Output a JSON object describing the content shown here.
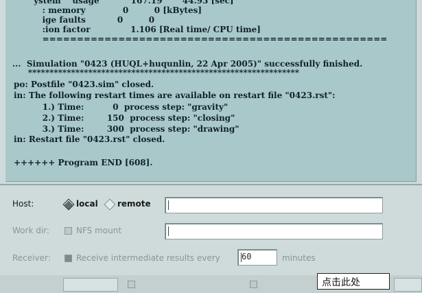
{
  "log": {
    "lines": [
      "      ystem    usage           167.19       44.93 [sec]",
      "         : memory             0         0 [kBytes]",
      "         ige faults           0         0",
      "         :ion factor              1.106 [Real time/ CPU time]",
      "         ==================================================",
      "",
      "...  Simulation \"0423 (HUQL+huqunlin, 22 Apr 2005)\" successfully finished.",
      "    ***************************************************************",
      "po: Postfile \"0423.sim\" closed.",
      "in: The following restart times are available on restart file \"0423.rst\":",
      "          1.) Time:          0  process step: \"gravity\"",
      "          2.) Time:        150  process step: \"closing\"",
      "          3.) Time:        300  process step: \"drawing\"",
      "in: Restart file \"0423.rst\" closed.",
      "",
      "++++++ Program END [608]."
    ]
  },
  "host": {
    "label": "Host:",
    "local_label": "local",
    "remote_label": "remote",
    "selected": "local",
    "value": ""
  },
  "workdir": {
    "label": "Work dir:",
    "nfs_label": "NFS mount",
    "value": ""
  },
  "receiver": {
    "label": "Receiver:",
    "checkbox_label": "Receive intermediate results every",
    "interval_value": "60",
    "unit_label": "minutes"
  },
  "tooltip": {
    "text": "点击此处"
  },
  "colors": {
    "log_bg": "#a9c8ca",
    "panel_bg": "#cfdbdb"
  }
}
